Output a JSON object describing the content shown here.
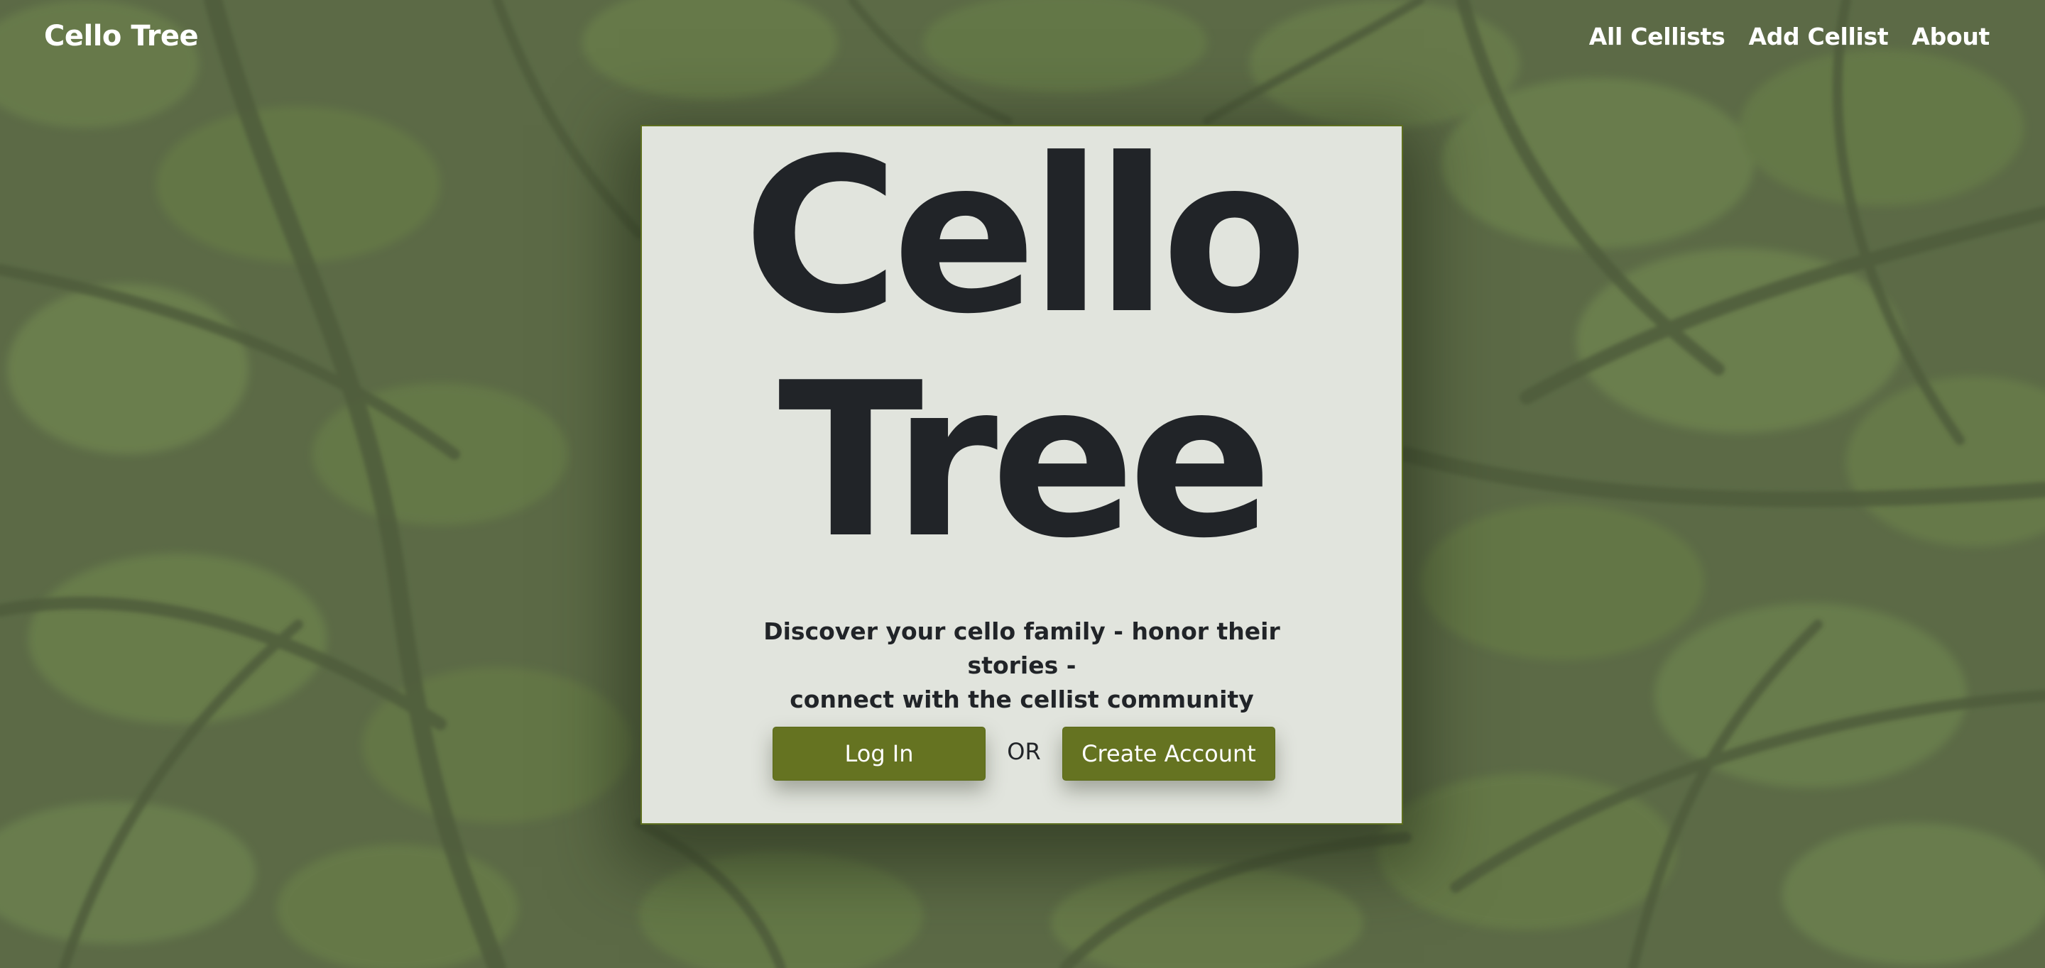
{
  "navbar": {
    "brand": "Cello Tree",
    "links": [
      {
        "label": "All Cellists"
      },
      {
        "label": "Add Cellist"
      },
      {
        "label": "About"
      }
    ]
  },
  "hero": {
    "title_line1": "Cello",
    "title_line2": "Tree",
    "tagline_line1": "Discover your cello family - honor their stories -",
    "tagline_line2": "connect with the cellist community",
    "login_label": "Log In",
    "or_label": "OR",
    "create_label": "Create Account"
  },
  "colors": {
    "background": "#5d6b48",
    "card": "#e1e4dd",
    "button": "#657321",
    "text_dark": "#212428",
    "text_light": "#ffffff"
  }
}
